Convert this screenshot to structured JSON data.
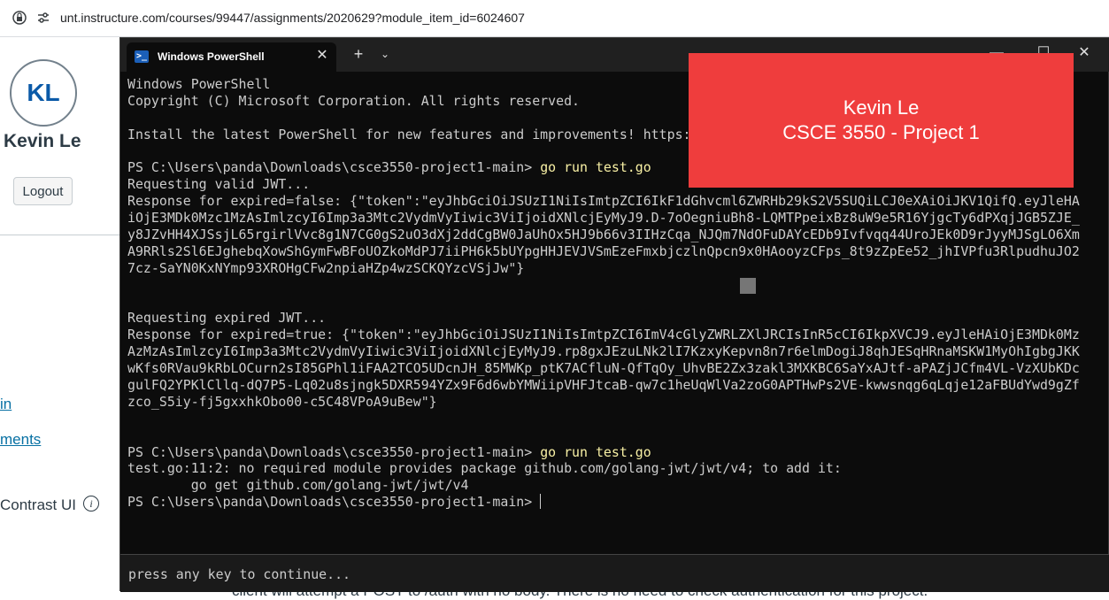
{
  "browser": {
    "url": "unt.instructure.com/courses/99447/assignments/2020629?module_item_id=6024607"
  },
  "canvas": {
    "avatar_initials": "KL",
    "user_name": "Kevin Le",
    "logout_label": "Logout",
    "partial_link_1": "in",
    "partial_link_2": "ments",
    "contrast_label": "Contrast UI",
    "bottom_text": "client will attempt a POST to /auth with no body. There is no need to check authentication for this project."
  },
  "powershell": {
    "tab_title": "Windows PowerShell",
    "overlay": {
      "line1": "Kevin Le",
      "line2": "CSCE 3550 - Project 1"
    },
    "lines": [
      {
        "text": "Windows PowerShell"
      },
      {
        "text": "Copyright (C) Microsoft Corporation. All rights reserved."
      },
      {
        "text": ""
      },
      {
        "text": "Install the latest PowerShell for new features and improvements! https://aka.ms/PSWindows"
      },
      {
        "text": ""
      },
      {
        "prompt": "PS C:\\Users\\panda\\Downloads\\csce3550-project1-main> ",
        "cmd": "go run test.go"
      },
      {
        "text": "Requesting valid JWT..."
      },
      {
        "text": "Response for expired=false: {\"token\":\"eyJhbGciOiJSUzI1NiIsImtpZCI6IkF1dGhvcml6ZWRHb29kS2V5SUQiLCJ0eXAiOiJKV1QifQ.eyJleHA"
      },
      {
        "text": "iOjE3MDk0Mzc1MzAsImlzcyI6Imp3a3Mtc2VydmVyIiwic3ViIjoidXNlcjEyMyJ9.D-7oOegniuBh8-LQMTPpeixBz8uW9e5R16YjgcTy6dPXqjJGB5ZJE_"
      },
      {
        "text": "y8JZvHH4XJSsjL65rgirlVvc8g1N7CG0gS2uO3dXj2ddCgBW0JaUhOx5HJ9b66v3IIHzCqa_NJQm7NdOFuDAYcEDb9Ivfvqq44UroJEk0D9rJyyMJSgLO6Xm"
      },
      {
        "text": "A9RRls2Sl6EJghebqXowShGymFwBFoUOZkoMdPJ7iiPH6k5bUYpgHHJEVJVSmEzeFmxbjczlnQpcn9x0HAooyzCFps_8t9zZpEe52_jhIVPfu3RlpudhuJO2"
      },
      {
        "text": "7cz-SaYN0KxNYmp93XROHgCFw2npiaHZp4wzSCKQYzcVSjJw\"}"
      },
      {
        "text": ""
      },
      {
        "text": ""
      },
      {
        "text": "Requesting expired JWT..."
      },
      {
        "text": "Response for expired=true: {\"token\":\"eyJhbGciOiJSUzI1NiIsImtpZCI6ImV4cGlyZWRLZXlJRCIsInR5cCI6IkpXVCJ9.eyJleHAiOjE3MDk0Mz"
      },
      {
        "text": "AzMzAsImlzcyI6Imp3a3Mtc2VydmVyIiwic3ViIjoidXNlcjEyMyJ9.rp8gxJEzuLNk2lI7KzxyKepvn8n7r6elmDogiJ8qhJESqHRnaMSKW1MyOhIgbgJKK"
      },
      {
        "text": "wKfs0RVau9kRbLOCurn2sI85GPhl1iFAA2TCO5UDcnJH_85MWKp_ptK7ACfluN-QfTqOy_UhvBE2Zx3zakl3MXKBC6SaYxAJtf-aPAZjJCfm4VL-VzXUbKDc"
      },
      {
        "text": "gulFQ2YPKlCllq-dQ7P5-Lq02u8sjngk5DXR594YZx9F6d6wbYMWiipVHFJtcaB-qw7c1heUqWlVa2zoG0APTHwPs2VE-kwwsnqg6qLqje12aFBUdYwd9gZf"
      },
      {
        "text": "zco_S5iy-fj5gxxhkObo00-c5C48VPoA9uBew\"}"
      },
      {
        "text": ""
      },
      {
        "text": ""
      },
      {
        "prompt": "PS C:\\Users\\panda\\Downloads\\csce3550-project1-main> ",
        "cmd": "go run test.go"
      },
      {
        "text": "test.go:11:2: no required module provides package github.com/golang-jwt/jwt/v4; to add it:"
      },
      {
        "text": "        go get github.com/golang-jwt/jwt/v4"
      },
      {
        "prompt": "PS C:\\Users\\panda\\Downloads\\csce3550-project1-main> ",
        "cursor": true
      }
    ],
    "bottom_message": "press any key to continue..."
  },
  "icons": {
    "lock": "lock-icon",
    "sliders": "tune-icon",
    "info": "info-icon"
  },
  "colors": {
    "overlay": "#ef3d3d",
    "terminal_bg": "#0c0c0c",
    "command": "#f9f1a5"
  }
}
